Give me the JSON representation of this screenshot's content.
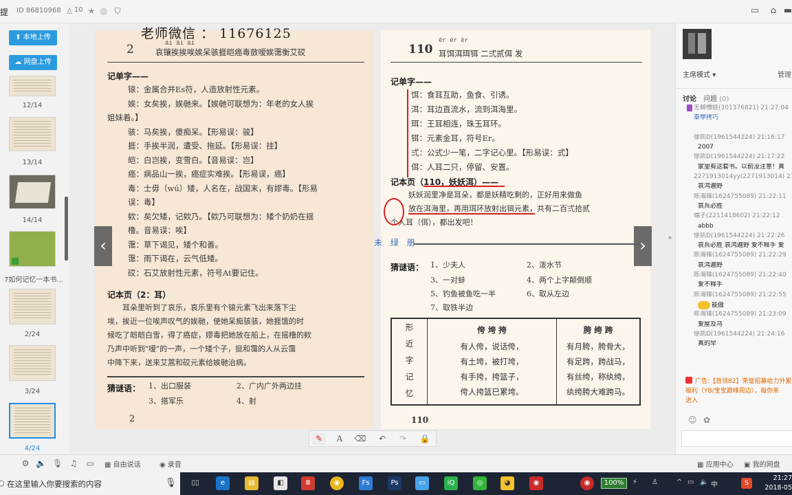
{
  "window": {
    "app_title": "提",
    "room_id": "ID 86810968",
    "user_count": "10"
  },
  "sidebar": {
    "upload_local": "本地上传",
    "upload_cloud": "网盘上传",
    "thumbnails": [
      {
        "label": "12/14"
      },
      {
        "label": "13/14"
      },
      {
        "label": "14/14"
      },
      {
        "label": "7如何记忆一本书..."
      },
      {
        "label": "2/24"
      },
      {
        "label": "3/24"
      },
      {
        "label": "4/24"
      }
    ]
  },
  "document": {
    "watermark": "老师微信 ： 11676125",
    "left_page": {
      "page_number": "2",
      "pinyin": "ái   āi           ài",
      "header_line": "哀镶挨挨唉娭呆骇捱皑癌毒敳嗳娭霭衡艾砹",
      "section1_title": "记单字——",
      "entries": [
        "锿：金属合并Es符，人造放射性元素。",
        "娭：女矣挨，娭毑来。【娭毑可联想为：年老的女人挨",
        "姐妹着。】",
        "骇：马矣挨，傻痴呆。【形易误：骏】",
        "捱：手挨半润，遭受、拖延。【形易误：挂】",
        "皑：白岂挨，变雪白。【音易误：岂】",
        "癌：病品山一挨，癌症实难挨。【形易误，癌】",
        "毒：士毋（wú）矮，人名在，战国末，有嫪毒。【形易",
        "    误：毒】",
        "欸：矣欠矮，记欸乃。【欸乃可联想为：矮个奶奶在揺",
        "    橹。音易误：唉】",
        "霭：草下谒见，矮个和善。",
        "霭：雨下谒在，云气低矮。",
        "砹：石艾放射性元素，符号At要记住。"
      ],
      "section2_title": "记本页（2：耳）",
      "passage": [
        "耳朵里听到了哀乐，哀乐里有个锿元素飞出来落下尘",
        "埃，挨近一位唉声叹气的娭毑，使她呆痴骇骇，她捱饿的时",
        "候吃了皑皑白雪，得了癌症，嫪毒把她放在船上，在摇橹的欸",
        "乃声中听到\"嗳\"的一声，一个矮个子，挺和霭的人从云霭",
        "中降下来，送来艾蒿和砹元素给娭毑治病。"
      ],
      "riddle_label": "猜谜语：",
      "riddles": [
        "1、出口服装",
        "2、广内广外两边挂",
        "3、搭军乐",
        "4、射"
      ],
      "footer_number": "2"
    },
    "right_page": {
      "page_number": "110",
      "pinyin": "ěr     ér     èr",
      "header_line": "耳饵洱珥铒  二弍贰佴  发",
      "section1_title": "记单字——",
      "entries": [
        "饵：食耳互助，鱼食、引诱。",
        "洱：耳边直流水，流到洱海里。",
        "珥：王耳相连，珠玉耳环。",
        "铒：元素金耳，符号Er。",
        "弍：公式少一笔，二字记心里。【形易误：式】",
        "佴：人耳二只，停留、安置。"
      ],
      "section2_title": "记本页（110，妖妖洱）——",
      "passage": [
        "妖妖润里净是耳朵，都是妖精吃剩的，正好用来做鱼",
        "放在洱海里，再用珥环放射出铒元素，共有二百弍拾贰",
        "个人耳（佴），都出发吧！"
      ],
      "riddle_label": "猜谜语：",
      "riddles": [
        "1、少夫人",
        "2、泼水节",
        "3、一对蚌",
        "4、两个上字颠倒顺",
        "5、钓鱼被鱼吃一半",
        "6、取从左边",
        "7、取铁半边"
      ],
      "table": {
        "side": [
          "形",
          "近",
          "字",
          "记",
          "忆"
        ],
        "col1_head": "侉  垮  挎",
        "col1_rows": [
          "有人侉，说话侉，",
          "有土垮，被打垮，",
          "有手挎，挎篮子，",
          "侉人挎篮巳累垮。"
        ],
        "col2_head": "胯  绔  跨",
        "col2_rows": [
          "有月胯，胯骨大，",
          "有足跨，跨战马，",
          "有丝绔，称纨绔，",
          "纨绔胯大难跨马。"
        ]
      },
      "footer_number": "110",
      "annotation": "未 绿 册"
    }
  },
  "draw_tools": {
    "icons": [
      "pen-icon",
      "text-icon",
      "eraser-icon",
      "undo-icon",
      "redo-icon",
      "lock-icon"
    ],
    "text_glyph": "A"
  },
  "right_panel": {
    "mode": "主席模式",
    "manage": "管理",
    "tab_discuss": "讨论",
    "tab_question": "问题",
    "question_count": "(0)",
    "chat": [
      {
        "type": "name",
        "text": "无聊傅娃(301376821) 21:27:04"
      },
      {
        "type": "name",
        "text": "泰學拷巧"
      },
      {
        "type": "spacer",
        "text": ""
      },
      {
        "type": "name",
        "text": "徐凯D(1961544224) 21:16:17"
      },
      {
        "type": "msg",
        "text": "2007"
      },
      {
        "type": "name",
        "text": "徐凯D(1961544224) 21:17:22"
      },
      {
        "type": "msg",
        "text": "家里有这套书。以前没注意！真"
      },
      {
        "type": "name",
        "text": "2271913014yy(2271913014) 21:..."
      },
      {
        "type": "msg",
        "text": "哀鸿遍野"
      },
      {
        "type": "name",
        "text": "陈海锋(1624755089) 21:22:11"
      },
      {
        "type": "msg",
        "text": "哀兵必胜"
      },
      {
        "type": "name",
        "text": "端子(2211418602) 21:22:12"
      },
      {
        "type": "msg",
        "text": "abbb"
      },
      {
        "type": "name",
        "text": "徐凯D(1961544224) 21:22:26"
      },
      {
        "type": "msg",
        "text": "哀兵必胜 哀鸿遍野 爱不释手 爱"
      },
      {
        "type": "name",
        "text": "陈海锋(1624755089) 21:22:29"
      },
      {
        "type": "msg",
        "text": "哀鸿遍野"
      },
      {
        "type": "name",
        "text": "陈海锋(1624755089) 21:22:40"
      },
      {
        "type": "msg",
        "text": "爱不释手"
      },
      {
        "type": "name",
        "text": "陈海锋(1624755089) 21:22:55"
      },
      {
        "type": "emoji",
        "text": "能做"
      },
      {
        "type": "name",
        "text": "陈海锋(1624755089) 21:23:09"
      },
      {
        "type": "msg",
        "text": "爱屋及乌"
      },
      {
        "type": "name",
        "text": "徐凯D(1961544224) 21:24:16"
      },
      {
        "type": "msg",
        "text": "真的早"
      }
    ],
    "ad_line1": "广告:【首领82】荣誉招募给力外累",
    "ad_line2": "福利（YB/宝宝巅峰周边），每你来",
    "ad_line3": "进入"
  },
  "control_bar": {
    "free_talk": "自由说话",
    "record": "录音",
    "app_center": "应用中心",
    "my_disk": "我的网盘"
  },
  "taskbar": {
    "search_placeholder": "在这里输入你要搜索的内容",
    "battery": "100%",
    "ime": "中",
    "time": "21:27",
    "date": "2018-05"
  }
}
